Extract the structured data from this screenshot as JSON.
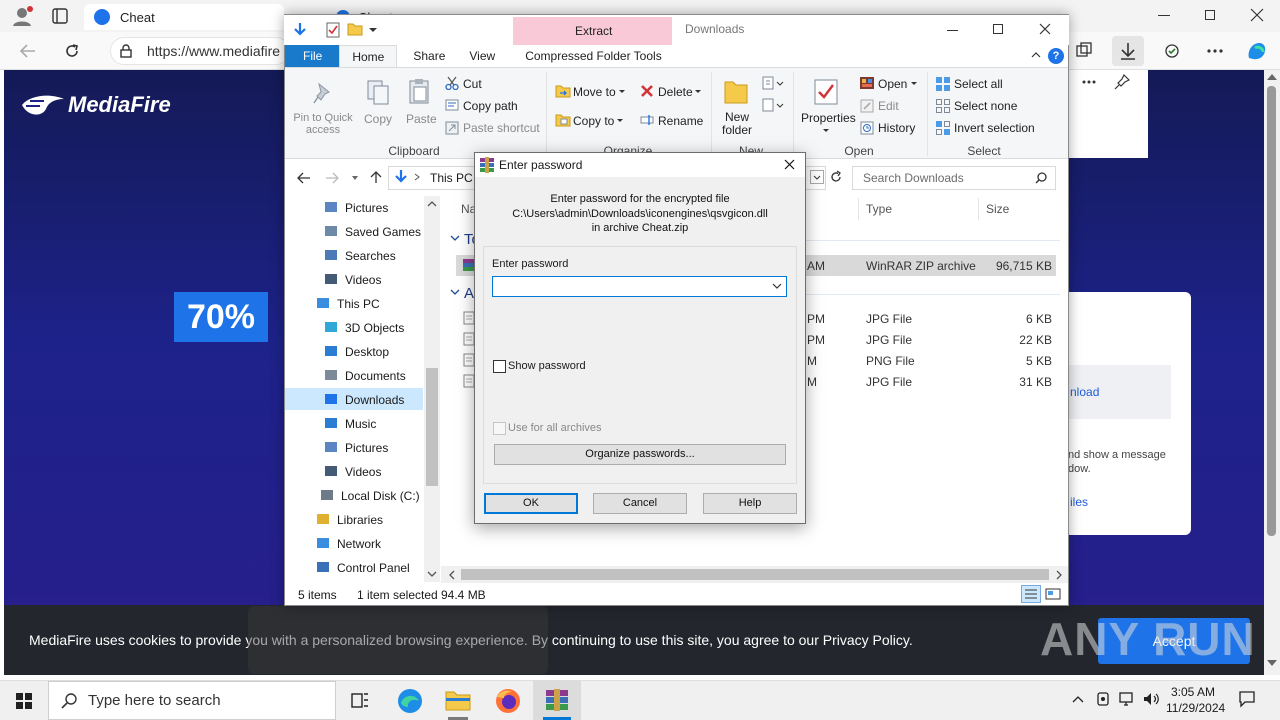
{
  "browser": {
    "tab_title": "Cheat",
    "tab2_title": "Cheat",
    "url": "https://www.mediafire",
    "nav_icons": [
      "back-icon",
      "refresh-icon",
      "lock-icon"
    ],
    "right_icons": [
      "collections-icon",
      "download-icon",
      "extensions-icon",
      "more-icon",
      "copilot-icon"
    ],
    "window_controls": [
      "minimize-icon",
      "restore-icon",
      "close-icon"
    ]
  },
  "webpage": {
    "logo": "MediaFire",
    "discount": "70%",
    "card_link": "nload",
    "card_text_1": "nd show a message",
    "card_text_2": "dow.",
    "card_link_2": "iles",
    "cookie_text": "MediaFire uses cookies to provide you with a personalized browsing experience. By continuing to use this site, you agree to our Privacy Policy.",
    "accept_label": "Accept",
    "watermark": "ANY RUN"
  },
  "explorer": {
    "title": "Downloads",
    "context_tab": "Extract",
    "tabs": [
      "File",
      "Home",
      "Share",
      "View",
      "Compressed Folder Tools"
    ],
    "ribbon": {
      "clipboard": {
        "pin": "Pin to Quick access",
        "copy": "Copy",
        "paste": "Paste",
        "cut": "Cut",
        "copy_path": "Copy path",
        "paste_shortcut": "Paste shortcut",
        "group": "Clipboard"
      },
      "organize": {
        "move_to": "Move to",
        "copy_to": "Copy to",
        "delete": "Delete",
        "rename": "Rename",
        "group": "Organize"
      },
      "new": {
        "new_folder": "New folder",
        "group": "New"
      },
      "open": {
        "properties": "Properties",
        "open": "Open",
        "edit": "Edit",
        "history": "History",
        "group": "Open"
      },
      "select": {
        "select_all": "Select all",
        "select_none": "Select none",
        "invert": "Invert selection",
        "group": "Select"
      }
    },
    "path": "This PC",
    "search_placeholder": "Search Downloads",
    "nav_items": [
      "Pictures",
      "Saved Games",
      "Searches",
      "Videos",
      "This PC",
      "3D Objects",
      "Desktop",
      "Documents",
      "Downloads",
      "Music",
      "Pictures",
      "Videos",
      "Local Disk (C:)",
      "Libraries",
      "Network",
      "Control Panel"
    ],
    "columns": {
      "name": "Na",
      "type": "Type",
      "size": "Size"
    },
    "group_today": "To",
    "group_earlier": "A",
    "files": [
      {
        "time": "AM",
        "type": "WinRAR ZIP archive",
        "size": "96,715 KB",
        "selected": true
      },
      {
        "time": "PM",
        "type": "JPG File",
        "size": "6 KB"
      },
      {
        "time": "PM",
        "type": "JPG File",
        "size": "22 KB"
      },
      {
        "time": "M",
        "type": "PNG File",
        "size": "5 KB"
      },
      {
        "time": "M",
        "type": "JPG File",
        "size": "31 KB"
      }
    ],
    "status": {
      "items": "5 items",
      "selected": "1 item selected",
      "size": "94.4 MB"
    }
  },
  "dialog": {
    "title": "Enter password",
    "message_line1": "Enter password for the encrypted file",
    "message_line2": "C:\\Users\\admin\\Downloads\\iconengines\\qsvgicon.dll",
    "message_line3": "in archive Cheat.zip",
    "field_label": "Enter password",
    "field_value": "",
    "show_password": "Show password",
    "use_for_all": "Use for all archives",
    "organize": "Organize passwords...",
    "ok": "OK",
    "cancel": "Cancel",
    "help": "Help"
  },
  "taskbar": {
    "search_placeholder": "Type here to search",
    "time": "3:05 AM",
    "date": "11/29/2024"
  }
}
